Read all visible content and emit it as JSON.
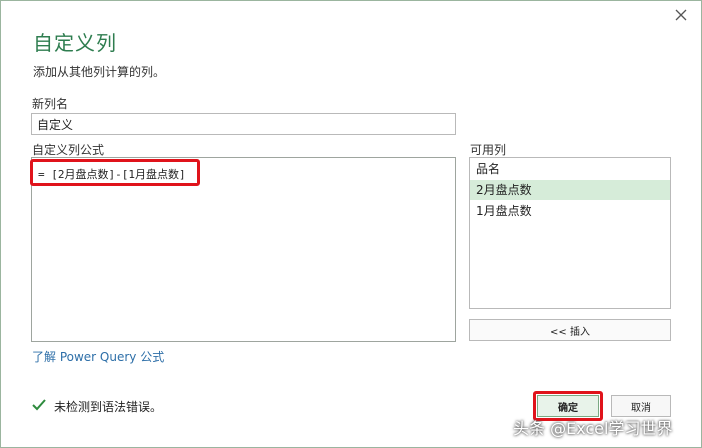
{
  "dialog": {
    "title": "自定义列",
    "subtitle": "添加从其他列计算的列。"
  },
  "new_column": {
    "label": "新列名",
    "value": "自定义"
  },
  "formula": {
    "label": "自定义列公式",
    "value": "= [2月盘点数]-[1月盘点数]"
  },
  "available_columns": {
    "label": "可用列",
    "items": [
      {
        "label": "品名"
      },
      {
        "label": "2月盘点数"
      },
      {
        "label": "1月盘点数"
      }
    ],
    "selected_index": 1,
    "insert_label": "<< 插入"
  },
  "learn_link": "了解 Power Query 公式",
  "status": {
    "text": "未检测到语法错误。",
    "icon": "checkmark-icon"
  },
  "buttons": {
    "ok_label": "确定",
    "cancel_label": "取消"
  },
  "watermark": "头条 @Excel学习世界",
  "colors": {
    "accent": "#2e7d4f",
    "highlight": "#e0131b",
    "selected_row": "#d6ecd9",
    "link": "#2e6fa8"
  }
}
